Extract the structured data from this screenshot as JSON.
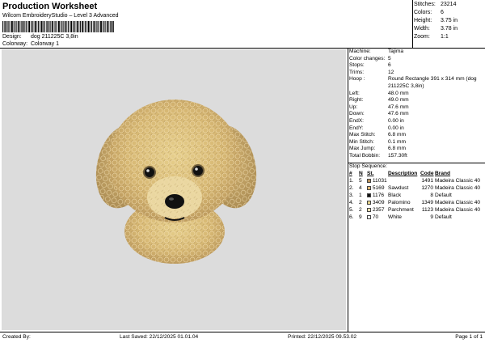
{
  "header": {
    "title": "Production Worksheet",
    "subtitle": "Wilcom EmbroideryStudio – Level 3 Advanced",
    "design_label": "Design:",
    "design_value": "dog 211225C 3,8in",
    "colorway_label": "Colorway:",
    "colorway_value": "Colorway 1"
  },
  "stats": [
    {
      "label": "Stitches:",
      "value": "23214"
    },
    {
      "label": "Colors:",
      "value": "6"
    },
    {
      "label": "Height:",
      "value": "3.75 in"
    },
    {
      "label": "Width:",
      "value": "3.78 in"
    },
    {
      "label": "Zoom:",
      "value": "1:1"
    }
  ],
  "machine_info": [
    {
      "label": "Machine:",
      "value": "Tajima"
    },
    {
      "label": "Color changes:",
      "value": "5"
    },
    {
      "label": "Stops:",
      "value": "6"
    },
    {
      "label": "Trims:",
      "value": "12"
    },
    {
      "label": "Hoop :",
      "value": "Round Rectangle 391 x 314 mm (dog 211225C 3,8in)"
    },
    {
      "label": "Left:",
      "value": "48.0 mm"
    },
    {
      "label": "Right:",
      "value": "49.0 mm"
    },
    {
      "label": "Up:",
      "value": "47.6 mm"
    },
    {
      "label": "Down:",
      "value": "47.6 mm"
    },
    {
      "label": "EndX:",
      "value": "0.00 in"
    },
    {
      "label": "EndY:",
      "value": "0.00 in"
    },
    {
      "label": "Max Stitch:",
      "value": "6.8 mm"
    },
    {
      "label": "Min Stitch:",
      "value": "0.1 mm"
    },
    {
      "label": "Max Jump:",
      "value": "6.8 mm"
    },
    {
      "label": "Total Bobbin:",
      "value": "157.30ft"
    }
  ],
  "stop_sequence": {
    "title": "Stop Sequence:",
    "columns": [
      "#",
      "N",
      "St.",
      "Description",
      "Code",
      "Brand"
    ],
    "rows": [
      {
        "num": "1.",
        "n": "5",
        "color": "#b8915a",
        "st": "11031",
        "desc": "",
        "code": "1491",
        "brand": "Madeira Classic 40"
      },
      {
        "num": "2.",
        "n": "4",
        "color": "#e3b974",
        "st": "5169",
        "desc": "Sawdust",
        "code": "1270",
        "brand": "Madeira Classic 40"
      },
      {
        "num": "3.",
        "n": "1",
        "color": "#111111",
        "st": "1176",
        "desc": "Black",
        "code": "8",
        "brand": "Default"
      },
      {
        "num": "4.",
        "n": "2",
        "color": "#e5d38b",
        "st": "3409",
        "desc": "Palomino",
        "code": "1349",
        "brand": "Madeira Classic 40"
      },
      {
        "num": "5.",
        "n": "2",
        "color": "#f2ddb0",
        "st": "2357",
        "desc": "Parchment",
        "code": "1123",
        "brand": "Madeira Classic 40"
      },
      {
        "num": "6.",
        "n": "9",
        "color": "#ffffff",
        "st": "70",
        "desc": "White",
        "code": "9",
        "brand": "Default"
      }
    ]
  },
  "footer": {
    "created_by": "Created By:",
    "last_saved": "Last Saved: 22/12/2025 01.01.04",
    "printed": "Printed: 22/12/2025 09.53.02",
    "page": "Page 1 of 1"
  }
}
